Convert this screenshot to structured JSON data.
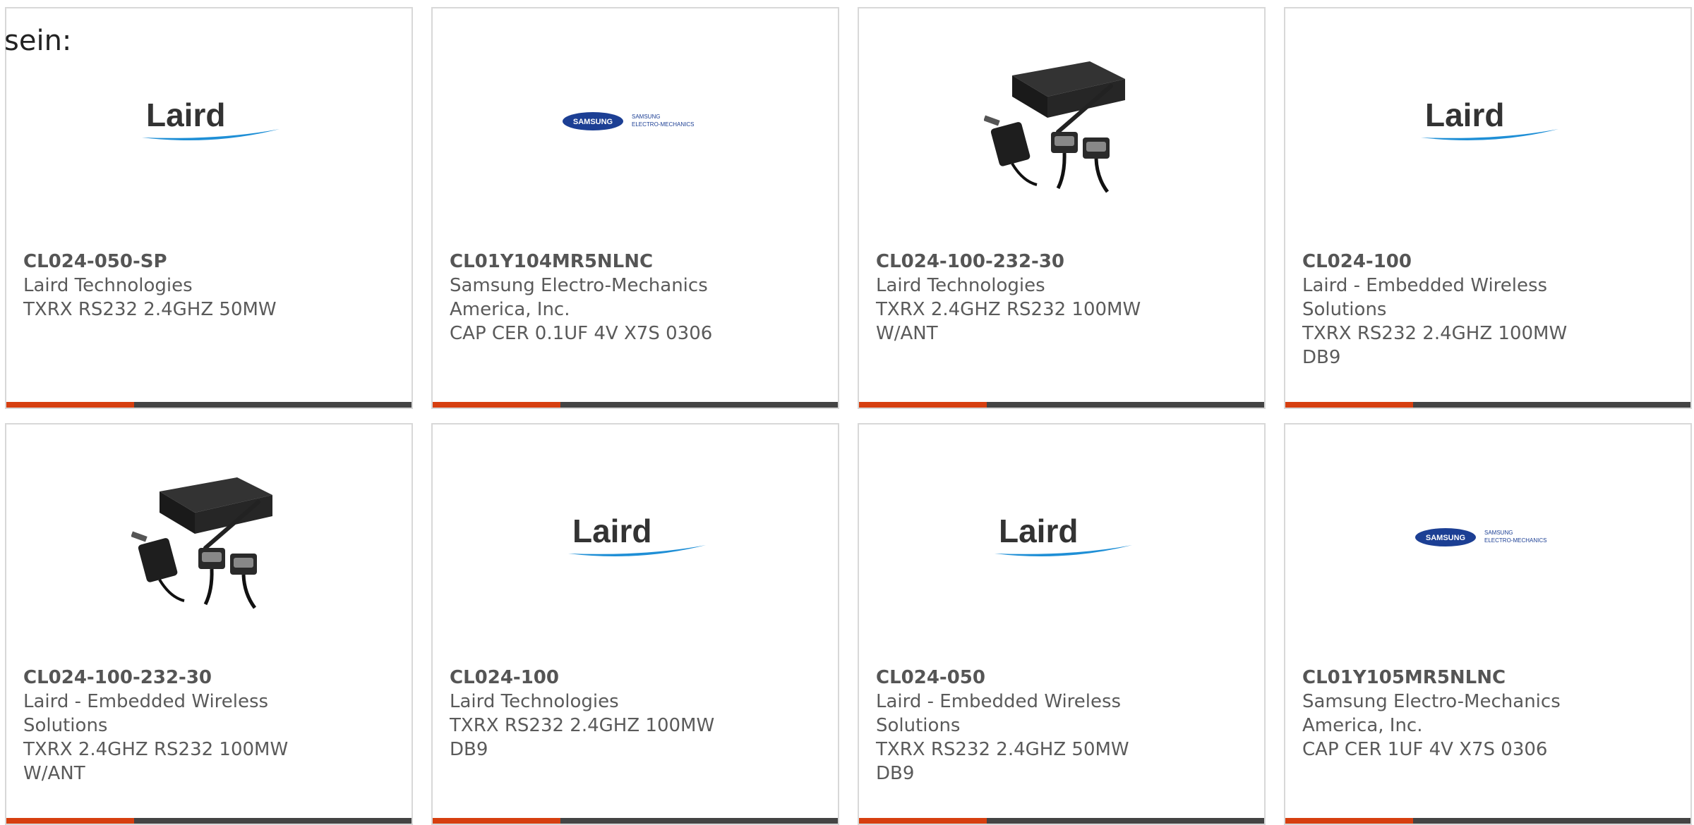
{
  "intro_text": "sein:",
  "colors": {
    "accent": "#d63f10",
    "bar": "#444444",
    "border": "#d8d8d8",
    "laird_swoosh": "#1f8fd6",
    "samsung_blue": "#1c3f94"
  },
  "products": [
    {
      "part_number": "CL024-050-SP",
      "manufacturer_line1": "Laird Technologies",
      "manufacturer_line2": "",
      "description_line1": "TXRX RS232 2.4GHZ 50MW",
      "description_line2": "",
      "image": "laird-logo",
      "logo_text": "Laird"
    },
    {
      "part_number": "CL01Y104MR5NLNC",
      "manufacturer_line1": "Samsung Electro-Mechanics",
      "manufacturer_line2": "America, Inc.",
      "description_line1": "CAP CER 0.1UF 4V X7S 0306",
      "description_line2": "",
      "image": "samsung-logo",
      "logo_text": "SAMSUNG",
      "logo_sub1": "SAMSUNG",
      "logo_sub2": "ELECTRO-MECHANICS"
    },
    {
      "part_number": "CL024-100-232-30",
      "manufacturer_line1": "Laird Technologies",
      "manufacturer_line2": "",
      "description_line1": "TXRX 2.4GHZ RS232 100MW",
      "description_line2": "W/ANT",
      "image": "radio-kit-photo"
    },
    {
      "part_number": "CL024-100",
      "manufacturer_line1": "Laird - Embedded Wireless",
      "manufacturer_line2": "Solutions",
      "description_line1": "TXRX RS232 2.4GHZ 100MW DB9",
      "description_line2": "",
      "image": "laird-logo",
      "logo_text": "Laird"
    },
    {
      "part_number": "CL024-100-232-30",
      "manufacturer_line1": "Laird - Embedded Wireless",
      "manufacturer_line2": "Solutions",
      "description_line1": "TXRX 2.4GHZ RS232 100MW",
      "description_line2": "W/ANT",
      "image": "radio-kit-photo"
    },
    {
      "part_number": "CL024-100",
      "manufacturer_line1": "Laird Technologies",
      "manufacturer_line2": "",
      "description_line1": "TXRX RS232 2.4GHZ 100MW DB9",
      "description_line2": "",
      "image": "laird-logo",
      "logo_text": "Laird"
    },
    {
      "part_number": "CL024-050",
      "manufacturer_line1": "Laird - Embedded Wireless",
      "manufacturer_line2": "Solutions",
      "description_line1": "TXRX RS232 2.4GHZ 50MW DB9",
      "description_line2": "",
      "image": "laird-logo",
      "logo_text": "Laird"
    },
    {
      "part_number": "CL01Y105MR5NLNC",
      "manufacturer_line1": "Samsung Electro-Mechanics",
      "manufacturer_line2": "America, Inc.",
      "description_line1": "CAP CER 1UF 4V X7S 0306",
      "description_line2": "",
      "image": "samsung-logo",
      "logo_text": "SAMSUNG",
      "logo_sub1": "SAMSUNG",
      "logo_sub2": "ELECTRO-MECHANICS"
    }
  ]
}
